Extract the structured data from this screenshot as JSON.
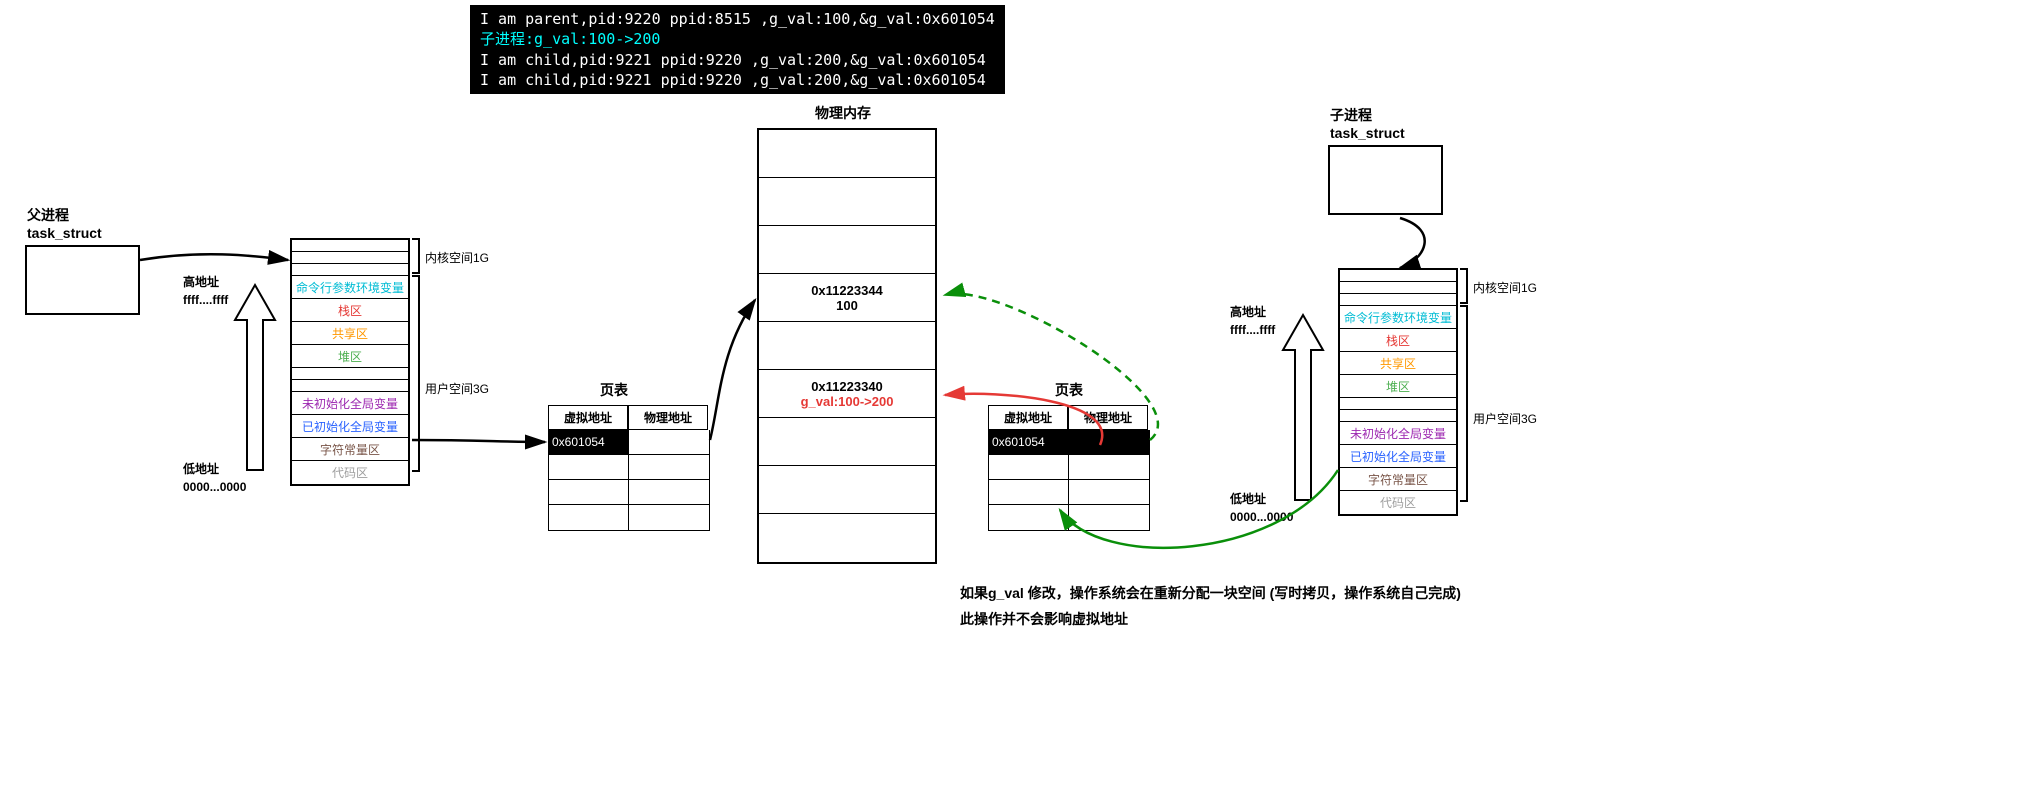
{
  "terminal": {
    "line1": "I am parent,pid:9220 ppid:8515 ,g_val:100,&g_val:0x601054",
    "line2": "子进程:g_val:100->200",
    "line3": "I am child,pid:9221 ppid:9220 ,g_val:200,&g_val:0x601054",
    "line4": "I am child,pid:9221 ppid:9220 ,g_val:200,&g_val:0x601054"
  },
  "parent": {
    "title1": "父进程",
    "title2": "task_struct",
    "high_addr_label": "高地址",
    "high_addr_val": "ffff....ffff",
    "low_addr_label": "低地址",
    "low_addr_val": "0000...0000",
    "kernel_label": "内核空间1G",
    "user_label": "用户空间3G",
    "sections": {
      "cmdline": "命令行参数环境变量",
      "stack": "栈区",
      "shared": "共享区",
      "heap": "堆区",
      "bss": "未初始化全局变量",
      "data": "已初始化全局变量",
      "rodata": "字符常量区",
      "text": "代码区"
    }
  },
  "child": {
    "title1": "子进程",
    "title2": "task_struct",
    "high_addr_label": "高地址",
    "high_addr_val": "ffff....ffff",
    "low_addr_label": "低地址",
    "low_addr_val": "0000...0000",
    "kernel_label": "内核空间1G",
    "user_label": "用户空间3G",
    "sections": {
      "cmdline": "命令行参数环境变量",
      "stack": "栈区",
      "shared": "共享区",
      "heap": "堆区",
      "bss": "未初始化全局变量",
      "data": "已初始化全局变量",
      "rodata": "字符常量区",
      "text": "代码区"
    }
  },
  "page_table": {
    "title": "页表",
    "col1": "虚拟地址",
    "col2": "物理地址",
    "entry": "0x601054"
  },
  "phys_mem": {
    "title": "物理内存",
    "cell1_addr": "0x11223344",
    "cell1_val": "100",
    "cell2_addr": "0x11223340",
    "cell2_val": "g_val:100->200"
  },
  "footnote": {
    "line1": "如果g_val 修改，操作系统会在重新分配一块空间 (写时拷贝，操作系统自己完成)",
    "line2": "此操作并不会影响虚拟地址"
  }
}
